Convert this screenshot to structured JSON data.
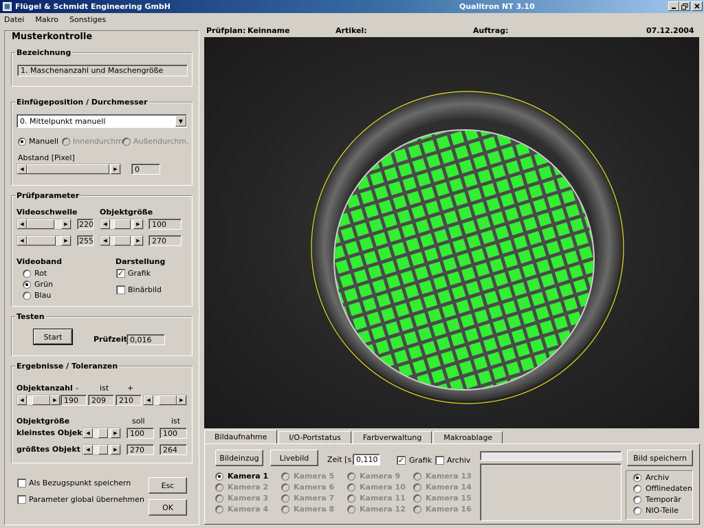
{
  "window": {
    "title": "Flügel & Schmidt  Engineering GmbH",
    "app_version": "Qualitron NT  3.10"
  },
  "menu": [
    "Datei",
    "Makro",
    "Sonstiges"
  ],
  "info": {
    "pruefplan_label": "Prüfplan:",
    "pruefplan_value": "Keinname",
    "artikel_label": "Artikel:",
    "auftrag_label": "Auftrag:",
    "date": "07.12.2004"
  },
  "panel": {
    "title": "Musterkontrolle",
    "bezeichnung": {
      "title": "Bezeichnung",
      "value": "1.  Maschenanzahl und Maschengröße"
    },
    "einfuege": {
      "title": "Einfügeposition / Durchmesser",
      "dropdown": "0. Mittelpunkt manuell",
      "radio_manuell": "Manuell",
      "radio_innen": "Innendurchm.",
      "radio_aussen": "Außendurchm.",
      "abstand_label": "Abstand [Pixel]",
      "abstand_value": "0"
    },
    "pruefparameter": {
      "title": "Prüfparameter",
      "videoschwelle_label": "Videoschwelle",
      "videoschwelle_min": "220",
      "videoschwelle_max": "255",
      "objektgroesse_label": "Objektgröße",
      "objektgroesse_min": "100",
      "objektgroesse_max": "270",
      "videoband_label": "Videoband",
      "band_rot": "Rot",
      "band_gruen": "Grün",
      "band_blau": "Blau",
      "darstellung_label": "Darstellung",
      "grafik": "Grafik",
      "binaerbild": "Binärbild"
    },
    "testen": {
      "title": "Testen",
      "start": "Start",
      "pruefzeit_label": "Prüfzeit",
      "pruefzeit_value": "0,016"
    },
    "ergebnisse": {
      "title": "Ergebnisse / Toleranzen",
      "objektanzahl_label": "Objektanzahl",
      "minus": "-",
      "ist": "ist",
      "plus": "+",
      "anzahl_min": "190",
      "anzahl_ist": "209",
      "anzahl_max": "210",
      "objektgroesse_label": "Objektgröße",
      "soll": "soll",
      "ist2": "ist",
      "kleinstes_label": "kleinstes Objekt",
      "kleinstes_soll": "100",
      "kleinstes_ist": "100",
      "groesstes_label": "größtes Objekt",
      "groesstes_soll": "270",
      "groesstes_ist": "264"
    },
    "bezugspunkt": "Als Bezugspunkt speichern",
    "parameter_global": "Parameter global übernehmen",
    "esc": "Esc",
    "ok": "OK"
  },
  "tabs": [
    "Bildaufnahme",
    "I/O-Portstatus",
    "Farbverwaltung",
    "Makroablage"
  ],
  "bildaufnahme": {
    "bildeinzug": "Bildeinzug",
    "livebild": "Livebild",
    "zeit_label": "Zeit [s]",
    "zeit_value": "0,110",
    "grafik": "Grafik",
    "archiv": "Archiv",
    "bild_speichern": "Bild speichern",
    "cameras": [
      "Kamera 1",
      "Kamera 2",
      "Kamera 3",
      "Kamera 4",
      "Kamera 5",
      "Kamera 6",
      "Kamera 7",
      "Kamera 8",
      "Kamera 9",
      "Kamera 10",
      "Kamera 11",
      "Kamera 12",
      "Kamera 13",
      "Kamera 14",
      "Kamera 15",
      "Kamera 16"
    ],
    "save_options": [
      "Archiv",
      "Offlinedaten",
      "Temporär",
      "NIO-Teile"
    ]
  },
  "colors": {
    "mesh_fill": "#33ee33",
    "mesh_wire": "#4a4a4a",
    "circle": "#e8e020",
    "titlebar": "#0a246a"
  }
}
